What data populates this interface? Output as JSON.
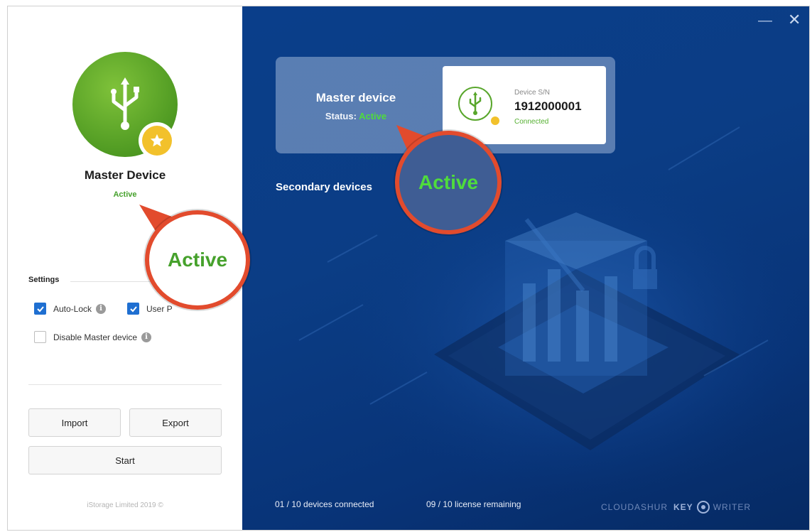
{
  "window": {
    "minimize_glyph": "—",
    "close_glyph": "✕"
  },
  "left_panel": {
    "device_name": "Master Device",
    "device_status": "Active",
    "settings_title": "Settings",
    "options": [
      {
        "label": "Auto-Lock",
        "checked": true
      },
      {
        "label": "User P",
        "checked": true
      },
      {
        "label": "Disable Master device",
        "checked": false
      }
    ],
    "info_glyph": "i",
    "buttons": {
      "import": "Import",
      "export": "Export",
      "start": "Start"
    },
    "copyright": "iStorage Limited 2019 ©"
  },
  "right_panel": {
    "master_card": {
      "title": "Master device",
      "status_prefix": "Status:",
      "status_value": "Active",
      "sn_label": "Device S/N",
      "sn_value": "1912000001",
      "sn_connection": "Connected"
    },
    "secondary_title": "Secondary devices",
    "footer": {
      "devices_connected": "01 / 10 devices connected",
      "license_remaining": "09 / 10 license remaining",
      "brand_cloud": "CLOUDASHUR",
      "brand_key": "KEY",
      "brand_writer": "WRITER"
    }
  },
  "callouts": {
    "left": "Active",
    "right": "Active"
  },
  "colors": {
    "accent_green": "#46a12c",
    "active_bright": "#4fdc3c",
    "callout_ring": "#e24b2d",
    "panel_blue": "#0a3e8a",
    "checkbox_blue": "#1f6fd1"
  }
}
